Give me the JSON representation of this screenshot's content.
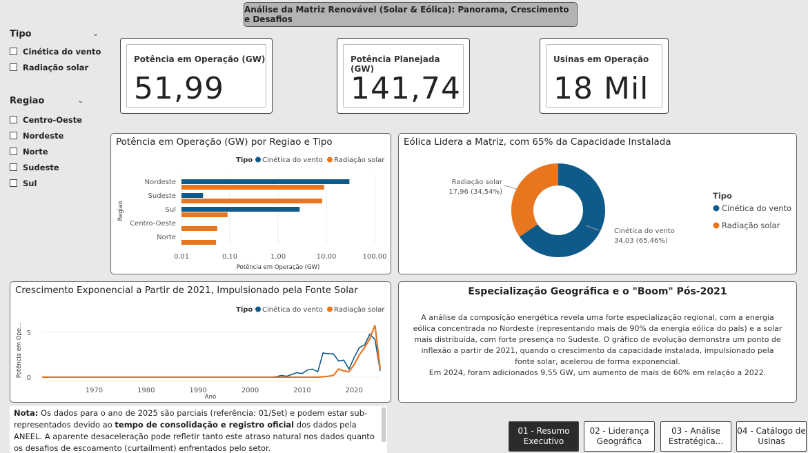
{
  "header": {
    "title": "Análise da Matriz Renovável (Solar & Eólica): Panorama, Crescimento e Desafios"
  },
  "filters": {
    "tipo": {
      "label": "Tipo",
      "items": [
        "Cinética do vento",
        "Radiação solar"
      ]
    },
    "regiao": {
      "label": "Regiao",
      "items": [
        "Centro-Oeste",
        "Nordeste",
        "Norte",
        "Sudeste",
        "Sul"
      ]
    }
  },
  "kpis": [
    {
      "label": "Potência em Operação (GW)",
      "value": "51,99"
    },
    {
      "label": "Potência Planejada (GW)",
      "value": "141,74"
    },
    {
      "label": "Usinas em Operação",
      "value": "18 Mil"
    }
  ],
  "colors": {
    "wind": "#0e5a8a",
    "solar": "#e8761f"
  },
  "bar_chart": {
    "title": "Potência em Operação (GW) por Regiao e Tipo",
    "legend_title": "Tipo",
    "chart_data": {
      "type": "bar",
      "orientation": "horizontal",
      "xscale": "log",
      "categories": [
        "Nordeste",
        "Sudeste",
        "Sul",
        "Centro-Oeste",
        "Norte"
      ],
      "series": [
        {
          "name": "Cinética do vento",
          "values": [
            30,
            0.028,
            2.8,
            null,
            null
          ]
        },
        {
          "name": "Radiação solar",
          "values": [
            9.0,
            8.2,
            0.09,
            0.055,
            0.052
          ]
        }
      ],
      "xticks": [
        "0,01",
        "0,10",
        "1,00",
        "10,00",
        "100,00"
      ],
      "xtick_values": [
        0.01,
        0.1,
        1,
        10,
        100
      ],
      "xlabel": "Potência em Operação (GW)",
      "ylabel": "Regiao",
      "xlim": [
        0.01,
        100
      ]
    }
  },
  "donut_chart": {
    "title": "Eólica Lidera a Matriz, com 65% da Capacidade Instalada",
    "legend_title": "Tipo",
    "chart_data": {
      "type": "pie",
      "labels": [
        "Cinética do vento",
        "Radiação solar"
      ],
      "values": [
        34.03,
        17.96
      ],
      "data_labels": [
        {
          "name": "Cinética do vento",
          "text": "34,03 (65,46%)"
        },
        {
          "name": "Radiação solar",
          "text": "17,96 (34,54%)"
        }
      ]
    }
  },
  "line_chart": {
    "title": "Crescimento Exponencial a Partir de 2021, Impulsionado pela Fonte Solar",
    "legend_title": "Tipo",
    "chart_data": {
      "type": "line",
      "xlabel": "Ano",
      "ylabel": "Potência em Ope...",
      "xlim": [
        1960,
        2025
      ],
      "ylim": [
        0,
        6
      ],
      "xticks": [
        1970,
        1980,
        1990,
        2000,
        2010,
        2020
      ],
      "yticks": [
        0,
        5
      ],
      "series": [
        {
          "name": "Cinética do vento",
          "x": [
            1960,
            2004,
            2005,
            2006,
            2007,
            2008,
            2009,
            2010,
            2011,
            2012,
            2013,
            2014,
            2015,
            2016,
            2017,
            2018,
            2019,
            2020,
            2021,
            2022,
            2023,
            2024,
            2025
          ],
          "y": [
            0,
            0,
            0.05,
            0.2,
            0.1,
            0.3,
            0.5,
            0.4,
            0.8,
            0.9,
            0.6,
            2.7,
            2.6,
            2.6,
            1.8,
            1.9,
            0.9,
            2.2,
            3.3,
            3.6,
            4.8,
            4.2,
            0.7
          ]
        },
        {
          "name": "Radiação solar",
          "x": [
            1960,
            2013,
            2014,
            2015,
            2016,
            2017,
            2018,
            2019,
            2020,
            2021,
            2022,
            2023,
            2024,
            2025
          ],
          "y": [
            0,
            0,
            0.05,
            0.1,
            0.2,
            0.9,
            0.7,
            0.6,
            1.4,
            2.5,
            3.3,
            4.3,
            5.8,
            0.9
          ]
        }
      ]
    }
  },
  "insight": {
    "title": "Especialização Geográfica e o \"Boom\" Pós-2021",
    "body1": "A análise da composição energética revela uma forte especialização regional, com a energia eólica concentrada no Nordeste (representando mais de 90% da energia eólica do país) e a solar mais distribuída, com forte presença no Sudeste. O gráfico de evolução demonstra um ponto de inflexão a partir de 2021, quando o crescimento da capacidade instalada, impulsionado pela fonte solar, acelerou de forma exponencial.",
    "body2": "Em 2024, foram adicionados 9,55 GW, um aumento de mais de 60% em relação a 2022."
  },
  "note": {
    "label": "Nota:",
    "text1": " Os dados para o ano de 2025 são parciais (referência: 01/Set) e podem estar sub-representados devido ao ",
    "bold": "tempo de consolidação e registro oficial",
    "text2": " dos dados pela ANEEL. A aparente desaceleração pode refletir tanto este atraso natural nos dados quanto os desafios de escoamento (curtailment) enfrentados pelo setor."
  },
  "nav": [
    {
      "label": "01 - Resumo Executivo",
      "active": true
    },
    {
      "label": "02 - Liderança Geográfica",
      "active": false
    },
    {
      "label": "03 - Análise Estratégica...",
      "active": false
    },
    {
      "label": "04 - Catálogo de Usinas",
      "active": false
    }
  ]
}
